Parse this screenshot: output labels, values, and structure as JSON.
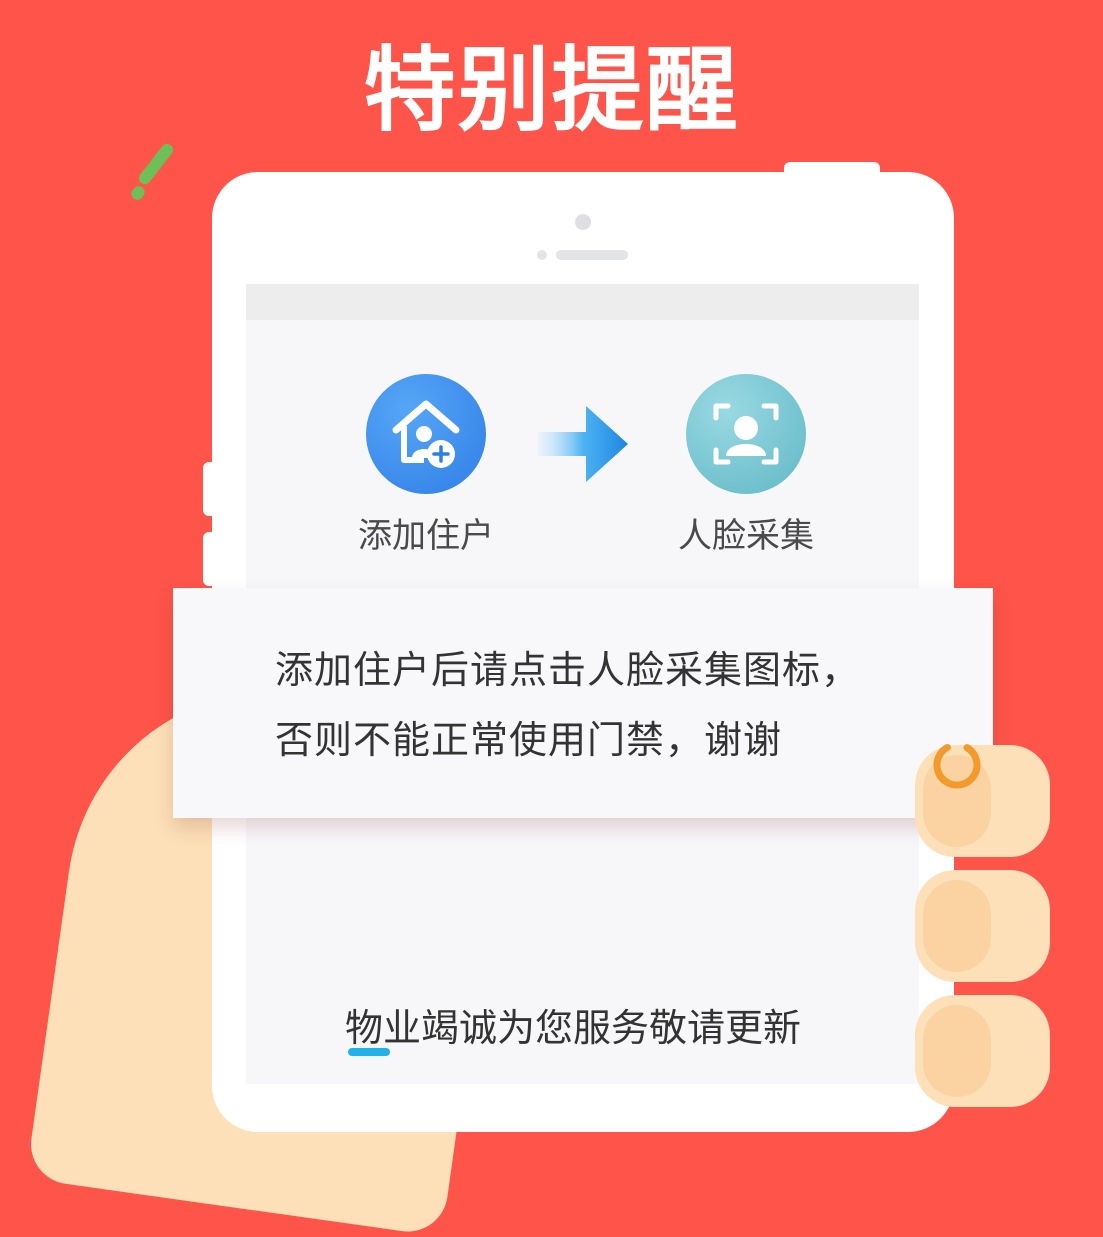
{
  "title": "特别提醒",
  "flow": {
    "step1": {
      "label": "添加住户",
      "icon": "house-add-user-icon",
      "color": "#3a8cf0"
    },
    "step2": {
      "label": "人脸采集",
      "icon": "face-scan-icon",
      "color": "#6ec3cf"
    },
    "arrow_icon": "arrow-right-icon"
  },
  "notice": {
    "line1": "添加住户后请点击人脸采集图标，",
    "line2": "否则不能正常使用门禁，谢谢"
  },
  "footer": {
    "text": "物业竭诚为您服务敬请更新"
  },
  "colors": {
    "background": "#fe5449",
    "accent_blue": "#22b2ea",
    "loader": "#f39a2c"
  }
}
